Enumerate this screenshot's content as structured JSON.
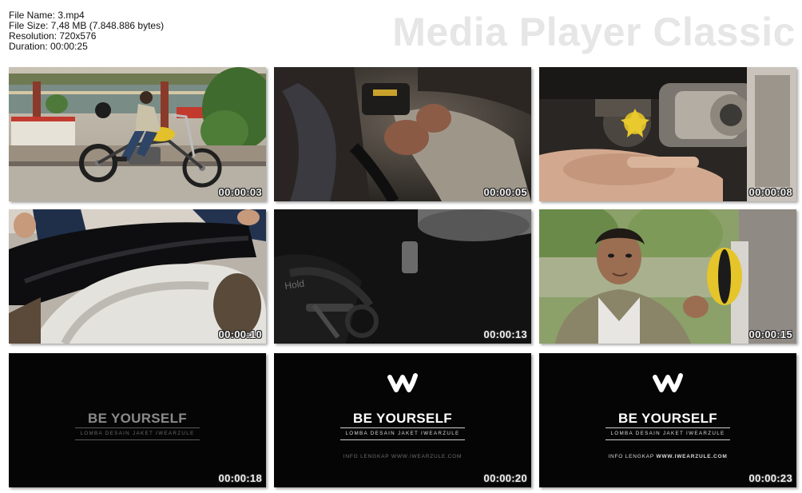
{
  "file_info": {
    "name_line": "File Name: 3.mp4",
    "size_line": "File Size: 7,48 MB (7.848.886 bytes)",
    "resolution_line": "Resolution: 720x576",
    "duration_line": "Duration: 00:00:25"
  },
  "brand": "Media Player Classic",
  "thumbnails": [
    {
      "timestamp": "00:00:03",
      "scene": "rider-on-motorcycle"
    },
    {
      "timestamp": "00:00:05",
      "scene": "hands-working-on-engine"
    },
    {
      "timestamp": "00:00:08",
      "scene": "carburetor-closeup"
    },
    {
      "timestamp": "00:00:10",
      "scene": "seat-and-fender"
    },
    {
      "timestamp": "00:00:13",
      "scene": "dark-engine-detail"
    },
    {
      "timestamp": "00:00:15",
      "scene": "portrait-with-bike"
    },
    {
      "timestamp": "00:00:18",
      "scene": "title-card"
    },
    {
      "timestamp": "00:00:20",
      "scene": "title-card"
    },
    {
      "timestamp": "00:00:23",
      "scene": "title-card"
    }
  ],
  "title_card": {
    "headline": "BE YOURSELF",
    "subline": "LOMBA DESAIN JAKET IWEARZULE",
    "footer_prefix": "INFO LENGKAP",
    "footer_url": "WWW.IWEARZULE.COM"
  },
  "scene_labels": {
    "fender_text": "Hold"
  },
  "colors": {
    "background": "#ffffff",
    "brand_text": "#e6e6e6",
    "timestamp_text": "#f2f2f2",
    "card_background": "#050505"
  }
}
